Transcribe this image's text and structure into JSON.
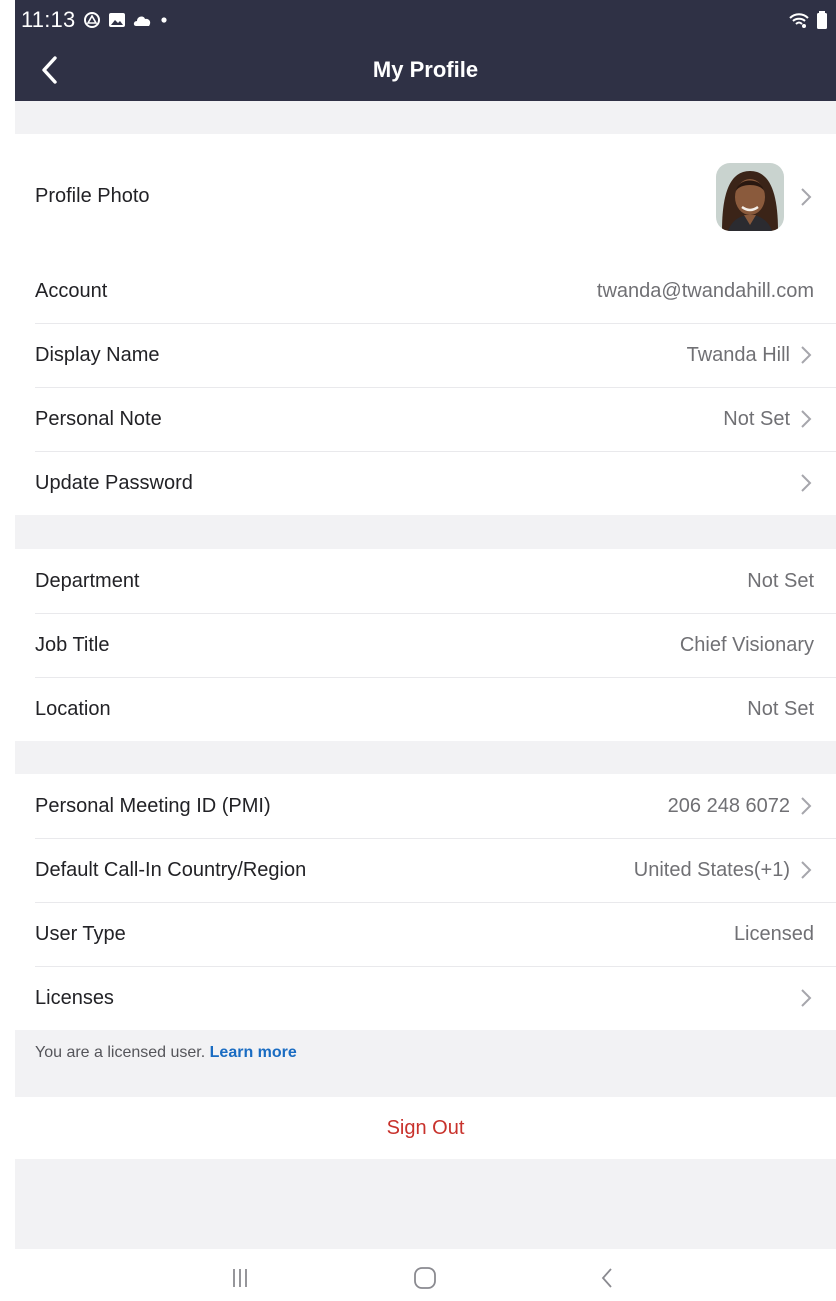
{
  "status_bar": {
    "time": "11:13",
    "left_icons": [
      "drive-icon",
      "image-icon",
      "cloud-icon",
      "dot-icon"
    ],
    "right_icons": [
      "wifi-icon",
      "battery-icon"
    ]
  },
  "header": {
    "title": "My Profile"
  },
  "sections": [
    {
      "rows": [
        {
          "label": "Profile Photo",
          "value": "",
          "chevron": true,
          "avatar": true
        }
      ]
    },
    {
      "rows": [
        {
          "label": "Account",
          "value": "twanda@twandahill.com",
          "chevron": false
        },
        {
          "label": "Display Name",
          "value": "Twanda Hill",
          "chevron": true
        },
        {
          "label": "Personal Note",
          "value": "Not Set",
          "chevron": true
        },
        {
          "label": "Update Password",
          "value": "",
          "chevron": true
        }
      ]
    },
    {
      "rows": [
        {
          "label": "Department",
          "value": "Not Set",
          "chevron": false
        },
        {
          "label": "Job Title",
          "value": "Chief Visionary",
          "chevron": false
        },
        {
          "label": "Location",
          "value": "Not Set",
          "chevron": false
        }
      ]
    },
    {
      "rows": [
        {
          "label": "Personal Meeting ID (PMI)",
          "value": "206 248 6072",
          "chevron": true
        },
        {
          "label": "Default Call-In Country/Region",
          "value": "United States(+1)",
          "chevron": true
        },
        {
          "label": "User Type",
          "value": "Licensed",
          "chevron": false
        },
        {
          "label": "Licenses",
          "value": "",
          "chevron": true
        }
      ]
    }
  ],
  "license_note": {
    "text": "You are a licensed user.",
    "link": "Learn more"
  },
  "sign_out": "Sign Out",
  "colors": {
    "header_bg": "#2f3145",
    "page_bg": "#f2f2f4",
    "sign_out": "#c8322c",
    "link": "#1a6cc2"
  }
}
